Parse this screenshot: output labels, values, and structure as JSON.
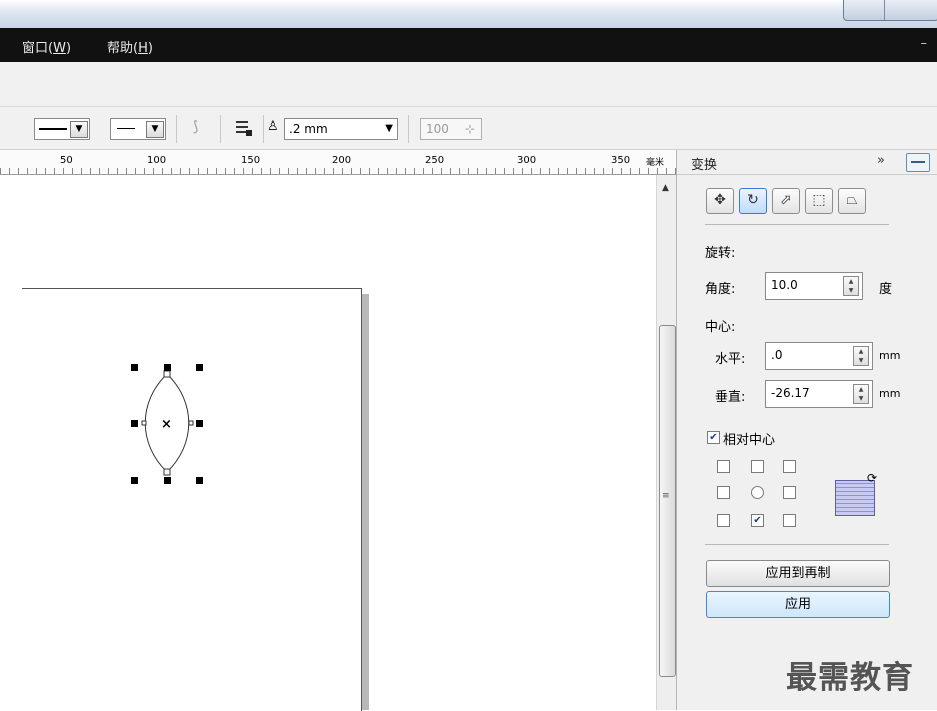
{
  "menubar": {
    "items": [
      {
        "label": "窗口(",
        "mnemonic": "W",
        "suffix": ")"
      },
      {
        "label": "帮助(",
        "mnemonic": "H",
        "suffix": ")"
      }
    ],
    "minimize_glyph": "–"
  },
  "toolbar": {
    "outline_width_value": ".2 mm",
    "percent_value": "100",
    "icons": [
      "line-style-icon",
      "arrow-style-icon",
      "wrap-icon",
      "outline-pen-icon"
    ]
  },
  "ruler": {
    "ticks": [
      "50",
      "100",
      "150",
      "200",
      "250",
      "300",
      "350"
    ],
    "unit": "毫米"
  },
  "docker": {
    "title": "变换",
    "expand_glyph": "»",
    "tabs": [
      "position",
      "rotate",
      "scale-mirror",
      "size",
      "skew"
    ],
    "active_tab": "rotate",
    "section_rotate": "旋转:",
    "angle_label": "角度:",
    "angle_value": "10.0",
    "angle_unit": "度",
    "center_label": "中心:",
    "horizontal_label": "水平:",
    "horizontal_value": ".0",
    "vertical_label": "垂直:",
    "vertical_value": "-26.17",
    "unit_mm": "mm",
    "relative_center_label": "相对中心",
    "relative_center_checked": true,
    "anchor_selected": "bottom-center",
    "apply_to_duplicate_label": "应用到再制",
    "apply_label": "应用"
  },
  "watermark": "最需教育",
  "colors": {
    "menubar_bg": "#111111",
    "active_button": "#3c8ad8",
    "anchor_grid": "#8f8fd6"
  }
}
